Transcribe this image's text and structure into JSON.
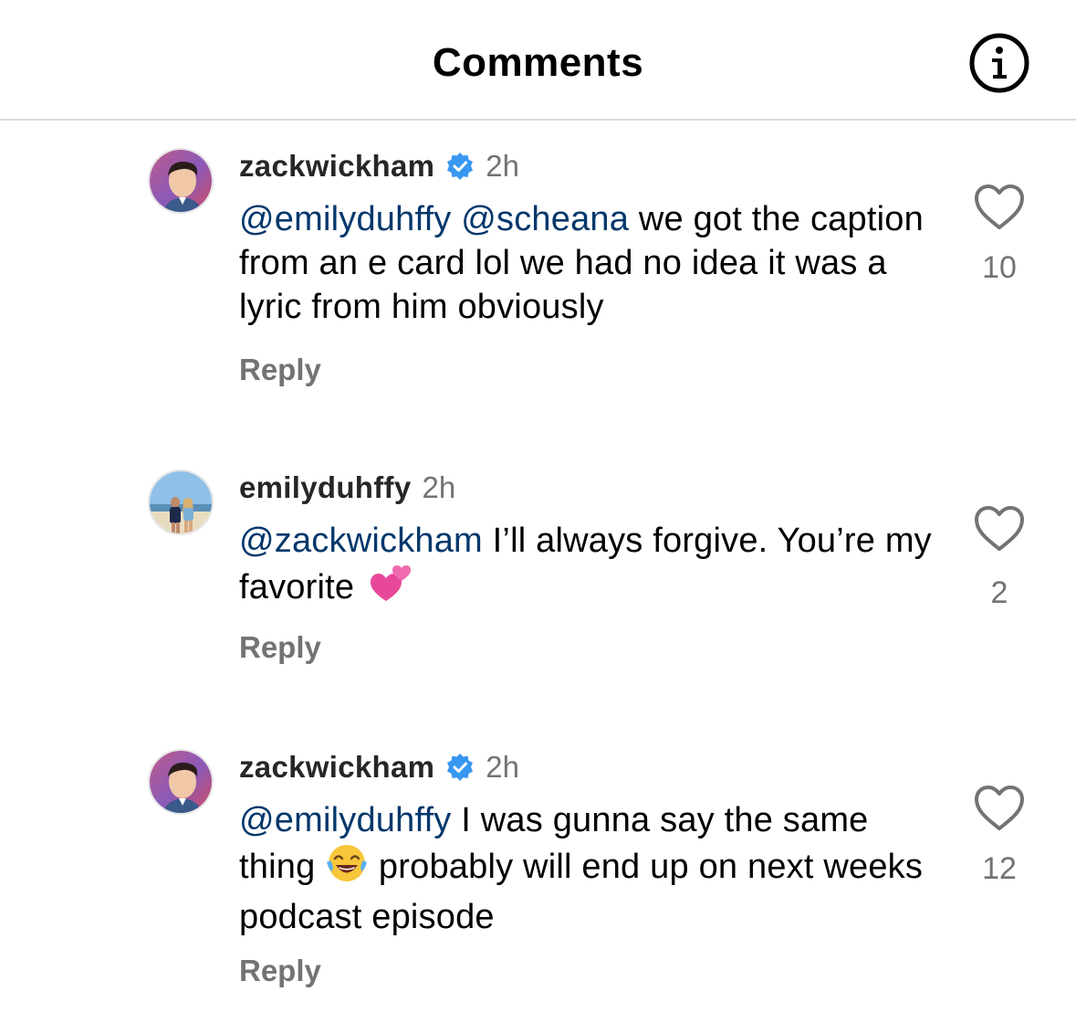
{
  "header": {
    "title": "Comments",
    "info_icon": "info-icon"
  },
  "comments": [
    {
      "username": "zackwickham",
      "verified": true,
      "time": "2h",
      "mentions": [
        "@emilyduhffy",
        "@scheana"
      ],
      "text": " we got the caption from an e card lol we had no idea it was a lyric from him obviously",
      "reply_label": "Reply",
      "like_count": "10"
    },
    {
      "username": "emilyduhffy",
      "verified": false,
      "time": "2h",
      "mentions": [
        "@zackwickham"
      ],
      "text": " I’ll always forgive. You’re my favorite",
      "emoji": "two-hearts-emoji",
      "reply_label": "Reply",
      "like_count": "2"
    },
    {
      "username": "zackwickham",
      "verified": true,
      "time": "2h",
      "mentions": [
        "@emilyduhffy"
      ],
      "text_before_emoji": " I was gunna say the same thing",
      "emoji": "tears-of-joy-emoji",
      "text_after_emoji": " probably will end up on next weeks podcast episode",
      "reply_label": "Reply",
      "like_count": "12"
    }
  ],
  "colors": {
    "mention": "#00376b",
    "secondary": "#737373",
    "verified": "#3897f0",
    "divider": "#dbdbdb"
  }
}
